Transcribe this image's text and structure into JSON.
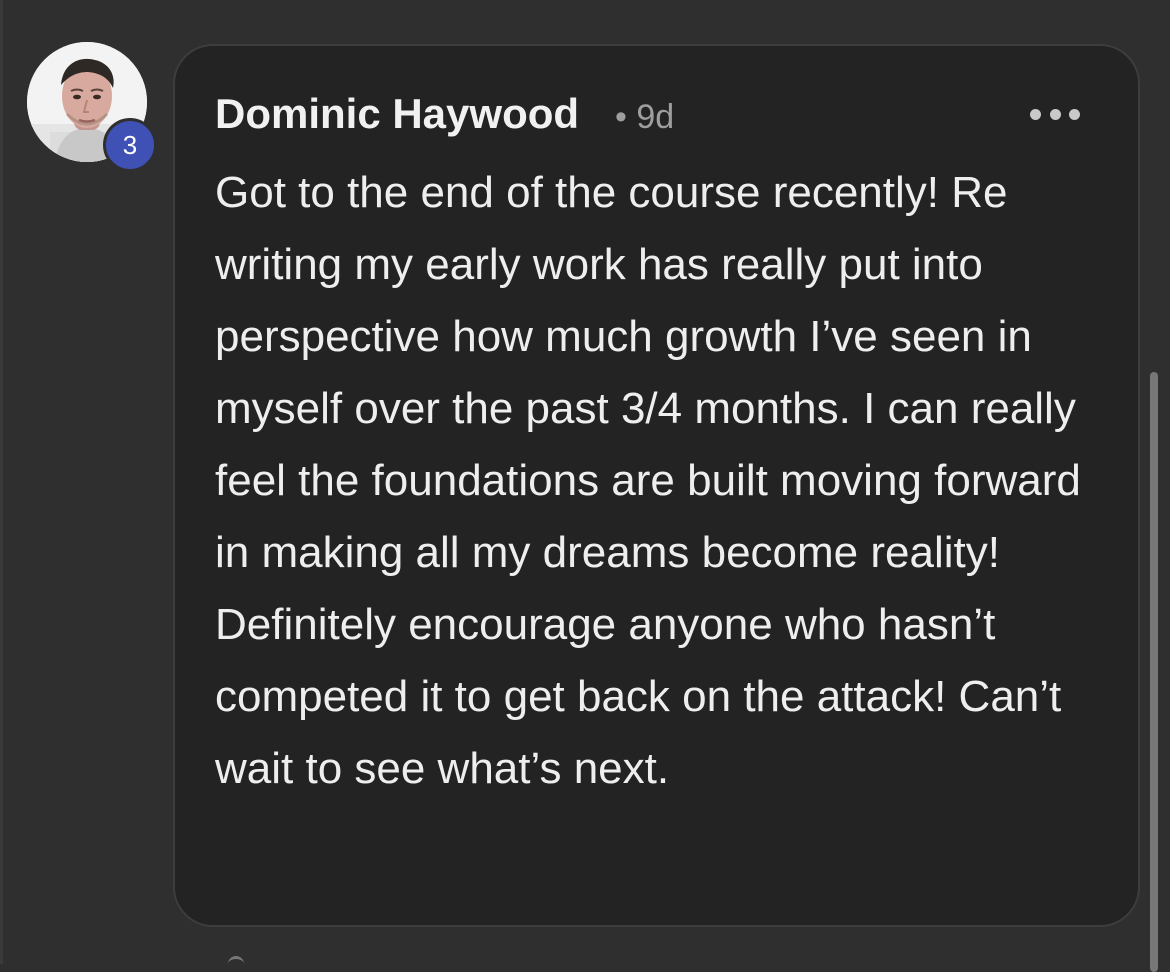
{
  "comment": {
    "author_name": "Dominic Haywood",
    "separator": "•",
    "age": "9d",
    "level": "3",
    "body": "Got to the end of the course recently! Re writing my early work has really put into perspective how much growth I’ve seen in myself over the past 3/4 months. I can really feel the foundations are built moving forward in making all my dreams become reality! Definitely encourage anyone who hasn’t competed it to get back on the attack! Can’t wait to see what’s next."
  },
  "icons": {
    "more": "more-horizontal-icon",
    "avatar": "user-photo-avatar"
  },
  "colors": {
    "page_background": "#2f2f2f",
    "card_background": "#232323",
    "level_badge": "#3f51b5",
    "primary_text": "#eeeeee",
    "secondary_text": "#9e9e9e"
  }
}
